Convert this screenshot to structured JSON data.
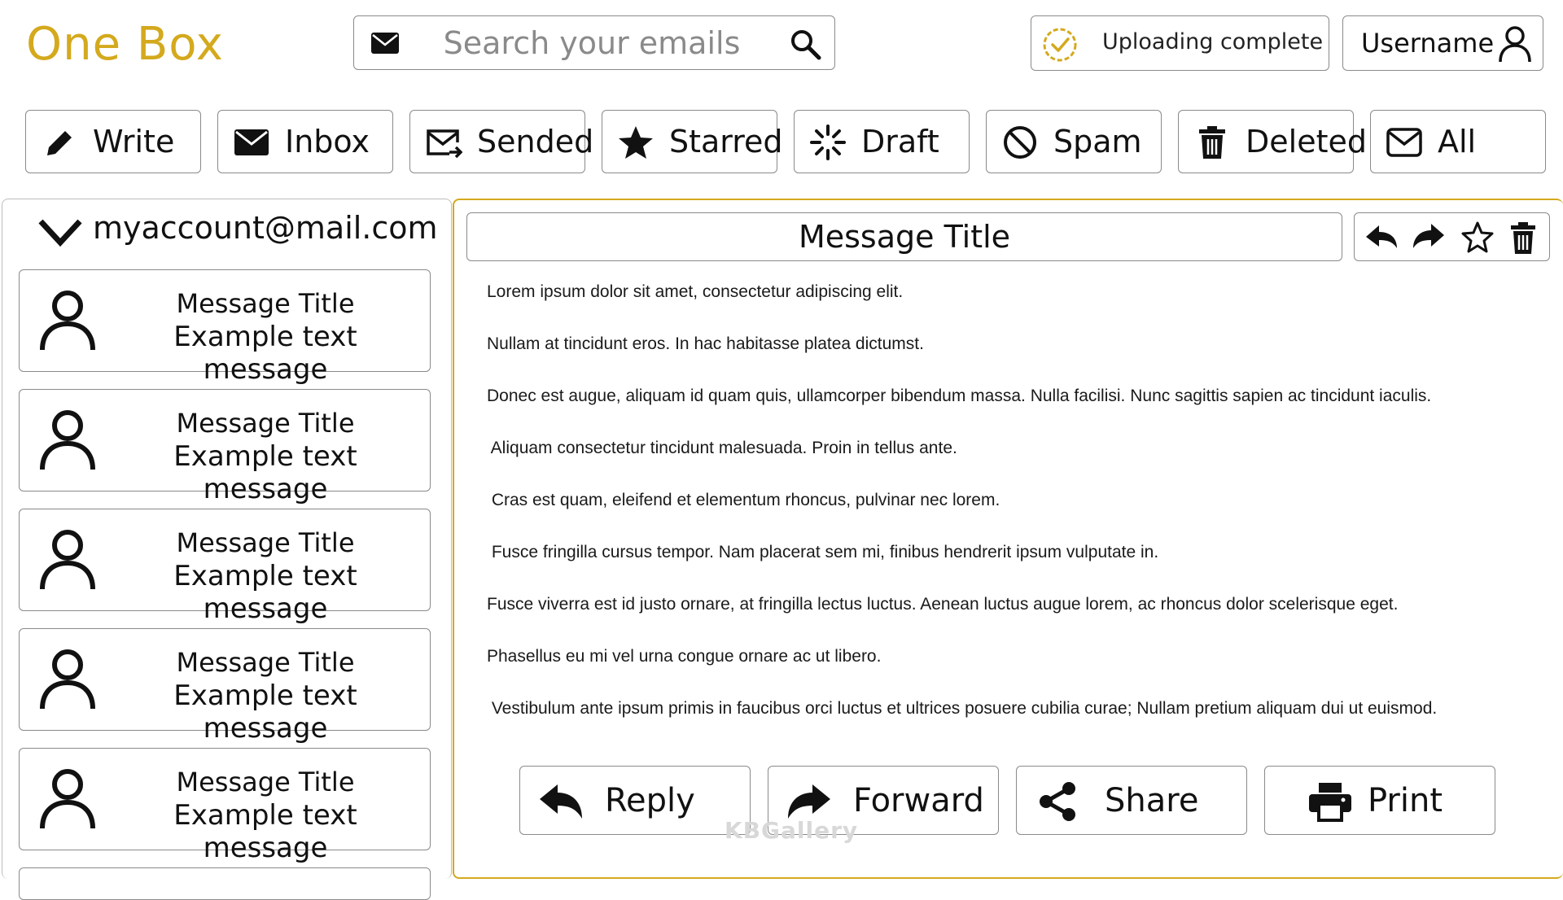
{
  "brand": {
    "name": "One Box",
    "color": "#d4a91d"
  },
  "search": {
    "placeholder": "Search your emails",
    "icon_left": "mail-icon",
    "icon_right": "search-icon"
  },
  "status": {
    "upload_text": "Uploading complete",
    "icon": "check-circle-icon"
  },
  "user": {
    "name": "Username",
    "icon": "user-icon"
  },
  "nav": [
    {
      "label": "Write",
      "icon": "pencil-icon"
    },
    {
      "label": "Inbox",
      "icon": "envelope-filled-icon"
    },
    {
      "label": "Sended",
      "icon": "envelope-send-icon"
    },
    {
      "label": "Starred",
      "icon": "star-icon"
    },
    {
      "label": "Draft",
      "icon": "loader-icon"
    },
    {
      "label": "Spam",
      "icon": "ban-icon"
    },
    {
      "label": "Deleted",
      "icon": "trash-icon"
    },
    {
      "label": "All",
      "icon": "envelope-outline-icon"
    }
  ],
  "account": {
    "email": "myaccount@mail.com"
  },
  "messages": [
    {
      "title": "Message Title",
      "preview": "Example text message"
    },
    {
      "title": "Message Title",
      "preview": "Example text message"
    },
    {
      "title": "Message Title",
      "preview": "Example text message"
    },
    {
      "title": "Message Title",
      "preview": "Example text message"
    },
    {
      "title": "Message Title",
      "preview": "Example text message"
    }
  ],
  "reader": {
    "title": "Message Title",
    "tools": [
      "reply-icon",
      "forward-icon",
      "star-outline-icon",
      "trash-icon"
    ],
    "body": [
      "Lorem ipsum dolor sit amet, consectetur adipiscing elit.",
      "Nullam at tincidunt eros. In hac habitasse platea dictumst.",
      "Donec est augue, aliquam id quam quis, ullamcorper bibendum massa. Nulla facilisi. Nunc sagittis sapien ac tincidunt iaculis.",
      " Aliquam consectetur tincidunt malesuada. Proin in tellus ante.",
      " Cras est quam, eleifend et elementum rhoncus, pulvinar nec lorem.",
      " Fusce fringilla cursus tempor. Nam placerat sem mi, finibus hendrerit ipsum vulputate in.",
      "Fusce viverra est id justo ornare, at fringilla lectus luctus. Aenean luctus augue lorem, ac rhoncus dolor scelerisque eget.",
      "Phasellus eu mi vel urna congue ornare ac ut libero.",
      " Vestibulum ante ipsum primis in faucibus orci luctus et ultrices posuere cubilia curae; Nullam pretium aliquam dui ut euismod."
    ],
    "actions": [
      {
        "label": "Reply",
        "icon": "reply-icon"
      },
      {
        "label": "Forward",
        "icon": "forward-icon"
      },
      {
        "label": "Share",
        "icon": "share-icon"
      },
      {
        "label": "Print",
        "icon": "print-icon"
      }
    ]
  },
  "watermark": "KBGallery"
}
